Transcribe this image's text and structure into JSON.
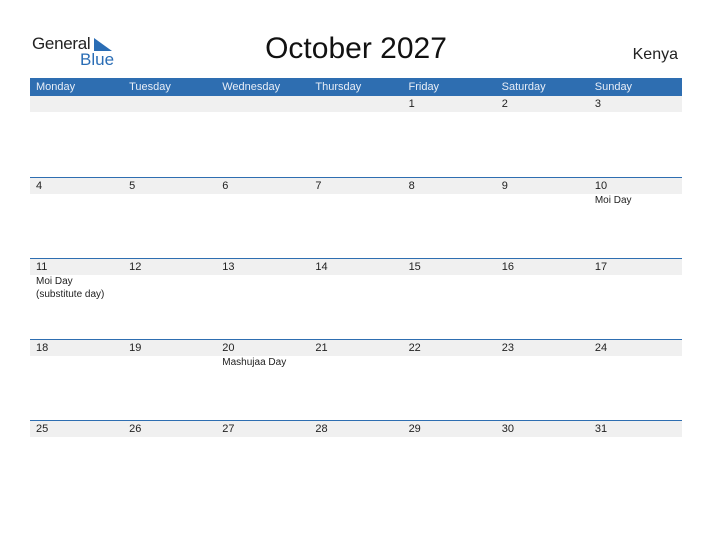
{
  "logo": {
    "general": "General",
    "blue": "Blue"
  },
  "title": "October 2027",
  "country": "Kenya",
  "colors": {
    "accent": "#2e6eb1",
    "strip": "#f0f0f0"
  },
  "weekdays": [
    "Monday",
    "Tuesday",
    "Wednesday",
    "Thursday",
    "Friday",
    "Saturday",
    "Sunday"
  ],
  "weeks": [
    {
      "days": [
        {
          "num": "",
          "holiday": ""
        },
        {
          "num": "",
          "holiday": ""
        },
        {
          "num": "",
          "holiday": ""
        },
        {
          "num": "",
          "holiday": ""
        },
        {
          "num": "1",
          "holiday": ""
        },
        {
          "num": "2",
          "holiday": ""
        },
        {
          "num": "3",
          "holiday": ""
        }
      ]
    },
    {
      "days": [
        {
          "num": "4",
          "holiday": ""
        },
        {
          "num": "5",
          "holiday": ""
        },
        {
          "num": "6",
          "holiday": ""
        },
        {
          "num": "7",
          "holiday": ""
        },
        {
          "num": "8",
          "holiday": ""
        },
        {
          "num": "9",
          "holiday": ""
        },
        {
          "num": "10",
          "holiday": "Moi Day"
        }
      ]
    },
    {
      "days": [
        {
          "num": "11",
          "holiday": "Moi Day",
          "holiday2": "(substitute day)"
        },
        {
          "num": "12",
          "holiday": ""
        },
        {
          "num": "13",
          "holiday": ""
        },
        {
          "num": "14",
          "holiday": ""
        },
        {
          "num": "15",
          "holiday": ""
        },
        {
          "num": "16",
          "holiday": ""
        },
        {
          "num": "17",
          "holiday": ""
        }
      ]
    },
    {
      "days": [
        {
          "num": "18",
          "holiday": ""
        },
        {
          "num": "19",
          "holiday": ""
        },
        {
          "num": "20",
          "holiday": "Mashujaa Day"
        },
        {
          "num": "21",
          "holiday": ""
        },
        {
          "num": "22",
          "holiday": ""
        },
        {
          "num": "23",
          "holiday": ""
        },
        {
          "num": "24",
          "holiday": ""
        }
      ]
    },
    {
      "days": [
        {
          "num": "25",
          "holiday": ""
        },
        {
          "num": "26",
          "holiday": ""
        },
        {
          "num": "27",
          "holiday": ""
        },
        {
          "num": "28",
          "holiday": ""
        },
        {
          "num": "29",
          "holiday": ""
        },
        {
          "num": "30",
          "holiday": ""
        },
        {
          "num": "31",
          "holiday": ""
        }
      ]
    }
  ]
}
